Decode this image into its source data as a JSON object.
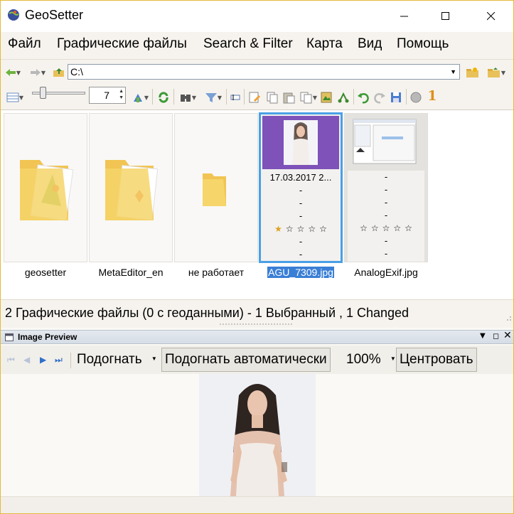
{
  "window": {
    "title": "GeoSetter"
  },
  "menu": [
    "Файл",
    "Графические файлы",
    "Search & Filter",
    "Карта",
    "Вид",
    "Помощь"
  ],
  "address": {
    "path": "C:\\"
  },
  "toolbar": {
    "thumb_size": "7",
    "number_badge": "1"
  },
  "thumbnails": [
    {
      "label": "geosetter",
      "type": "folder"
    },
    {
      "label": "MetaEditor_en",
      "type": "folder"
    },
    {
      "label": "не работает",
      "type": "folder"
    },
    {
      "label": "AGU_7309.jpg",
      "type": "image",
      "selected": true,
      "lines": [
        "17.03.2017 2...",
        "-",
        "-",
        "-",
        "-",
        "-"
      ]
    },
    {
      "label": "AnalogExif.jpg",
      "type": "image",
      "selected": false,
      "lines": [
        "-",
        "-",
        "-",
        "-",
        "-",
        "-",
        "-"
      ]
    }
  ],
  "status": {
    "text": "2 Графические файлы   (0 с геоданными)  - 1 Выбранный , 1 Changed"
  },
  "preview": {
    "panel_title": "Image Preview",
    "fit_label": "Подогнать",
    "fit_auto_button": "Подогнать автоматически",
    "zoom": "100%",
    "center_button": "Центровать"
  },
  "colors": {
    "selection_border": "#4aa0e6",
    "photo_bg": "#7e52b8",
    "window_border": "#e6b93a"
  }
}
